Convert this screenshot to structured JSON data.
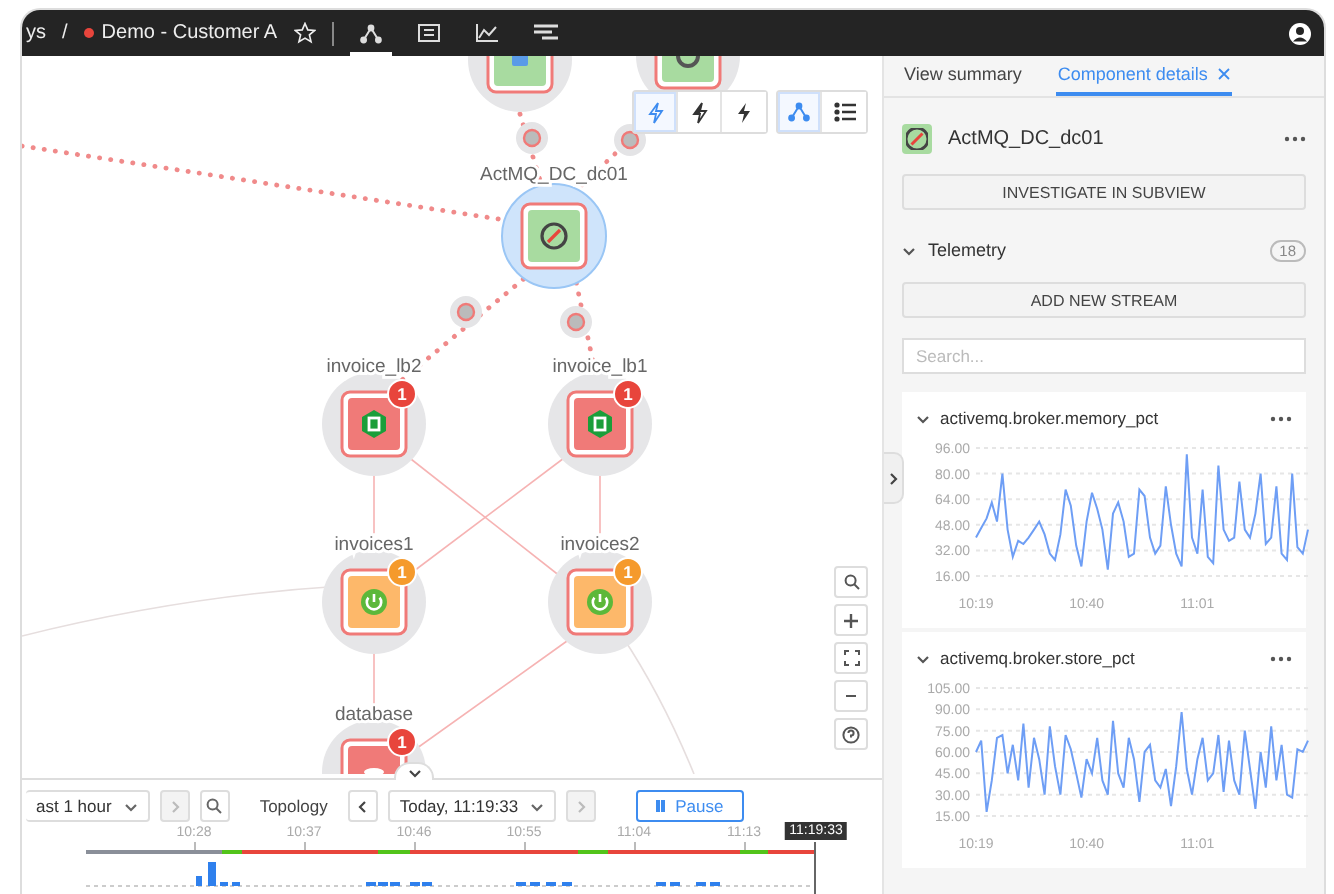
{
  "top_bar": {
    "breadcrumb": "ys",
    "separator": "/",
    "view": {
      "label": "Demo - Customer A",
      "color": "#e8453c",
      "favorite": false
    },
    "view_tabs": [
      {
        "kind": "topology",
        "selected": true
      },
      {
        "kind": "table",
        "selected": false
      },
      {
        "kind": "chart",
        "selected": false
      },
      {
        "kind": "events",
        "selected": false
      }
    ]
  },
  "graph_toolbar": {
    "filters": [
      {
        "kind": "bolt-outline",
        "selected": true
      },
      {
        "kind": "bolt-half",
        "selected": false
      },
      {
        "kind": "bolt",
        "selected": false
      }
    ],
    "views": [
      {
        "kind": "topology",
        "selected": true
      },
      {
        "kind": "list",
        "selected": false
      }
    ]
  },
  "graph": {
    "nodes": [
      {
        "kind": "app",
        "color": "#a8dba0",
        "selected": false
      },
      {
        "kind": "host",
        "color": "#a8dba0",
        "selected": false
      },
      {
        "label": "ActMQ_DC_dc01",
        "kind": "broker",
        "color": "#a8dba0",
        "selected": true
      },
      {
        "label": "invoice_lb2",
        "kind": "load-balancer",
        "color": "#f07a78",
        "badge": {
          "text": "1",
          "color": "#e8453c"
        },
        "selected": false
      },
      {
        "label": "invoice_lb1",
        "kind": "load-balancer",
        "color": "#f07a78",
        "badge": {
          "text": "1",
          "color": "#e8453c"
        },
        "selected": false
      },
      {
        "label": "invoices1",
        "kind": "service",
        "color": "#fdb86a",
        "badge": {
          "text": "1",
          "color": "#f59a2c"
        },
        "selected": false
      },
      {
        "label": "invoices2",
        "kind": "service",
        "color": "#fdb86a",
        "badge": {
          "text": "1",
          "color": "#f59a2c"
        },
        "selected": false
      },
      {
        "label": "database",
        "kind": "database",
        "color": "#f07a78",
        "badge": {
          "text": "1",
          "color": "#e8453c"
        },
        "selected": false
      }
    ]
  },
  "zoom_controls": [
    {
      "kind": "search"
    },
    {
      "kind": "zoom-in"
    },
    {
      "kind": "fit"
    },
    {
      "kind": "zoom-out"
    },
    {
      "kind": "help"
    }
  ],
  "timeline": {
    "expanded": true,
    "range": "ast 1 hour",
    "range_next_disabled": true,
    "mode": "Topology",
    "time": "Today, 11:19:33",
    "time_next_disabled": true,
    "pause": "Pause",
    "ticks": [
      "10:28",
      "10:37",
      "10:46",
      "10:55",
      "11:04",
      "11:13"
    ],
    "current": "11:19:33",
    "segments": [
      {
        "color": "#8a8f99"
      },
      {
        "color": "#52c41a"
      },
      {
        "color": "#e8453c"
      },
      {
        "color": "#52c41a"
      },
      {
        "color": "#e8453c"
      },
      {
        "color": "#52c41a"
      },
      {
        "color": "#e8453c"
      },
      {
        "color": "#52c41a"
      },
      {
        "color": "#e8453c"
      }
    ]
  },
  "panel": {
    "tabs": [
      {
        "label": "View summary",
        "selected": false,
        "closable": false
      },
      {
        "label": "Component details",
        "selected": true,
        "closable": true
      }
    ],
    "component": {
      "name": "ActMQ_DC_dc01",
      "color": "#a8dba0"
    },
    "investigate": "INVESTIGATE IN SUBVIEW",
    "telemetry": {
      "title": "Telemetry",
      "expanded": true,
      "count": "18",
      "add_button": "ADD NEW STREAM",
      "search": {
        "placeholder": "Search..."
      },
      "streams": [
        {
          "name": "activemq.broker.memory_pct",
          "expanded": true,
          "chart_data": {
            "type": "line",
            "grid": true,
            "ylim": [
              16,
              96
            ],
            "categories": [
              "10:19",
              null,
              null,
              null,
              null,
              null,
              null,
              null,
              null,
              null,
              null,
              null,
              null,
              null,
              null,
              null,
              null,
              null,
              null,
              null,
              null,
              "10:40",
              null,
              null,
              null,
              null,
              null,
              null,
              null,
              null,
              null,
              null,
              null,
              null,
              null,
              null,
              null,
              null,
              null,
              null,
              null,
              null,
              "11:01",
              null,
              null,
              null,
              null,
              null,
              null,
              null,
              null,
              null,
              null,
              null,
              null,
              null,
              null,
              null,
              null,
              null,
              null,
              null,
              null,
              null
            ],
            "yticks": [
              {
                "value": 16,
                "label": "16.00"
              },
              {
                "value": 32,
                "label": "32.00"
              },
              {
                "value": 48,
                "label": "48.00"
              },
              {
                "value": 64,
                "label": "64.00"
              },
              {
                "value": 80,
                "label": "80.00"
              },
              {
                "value": 96,
                "label": "96.00"
              }
            ],
            "series": [
              {
                "color": "#6e9ef5",
                "values": [
                  40,
                  46,
                  52,
                  62,
                  50,
                  80,
                  45,
                  28,
                  38,
                  36,
                  40,
                  45,
                  50,
                  42,
                  30,
                  26,
                  42,
                  70,
                  60,
                  35,
                  22,
                  50,
                  68,
                  58,
                  45,
                  20,
                  55,
                  62,
                  50,
                  28,
                  30,
                  70,
                  66,
                  40,
                  30,
                  35,
                  72,
                  48,
                  30,
                  22,
                  92,
                  40,
                  30,
                  70,
                  28,
                  24,
                  85,
                  45,
                  38,
                  40,
                  75,
                  45,
                  40,
                  55,
                  80,
                  36,
                  40,
                  72,
                  30,
                  26,
                  80,
                  34,
                  30,
                  45
                ]
              }
            ]
          }
        },
        {
          "name": "activemq.broker.store_pct",
          "expanded": true,
          "chart_data": {
            "type": "line",
            "grid": true,
            "ylim": [
              15,
              105
            ],
            "categories": [
              "10:19",
              null,
              null,
              null,
              null,
              null,
              null,
              null,
              null,
              null,
              null,
              null,
              null,
              null,
              null,
              null,
              null,
              null,
              null,
              null,
              null,
              "10:40",
              null,
              null,
              null,
              null,
              null,
              null,
              null,
              null,
              null,
              null,
              null,
              null,
              null,
              null,
              null,
              null,
              null,
              null,
              null,
              null,
              "11:01",
              null,
              null,
              null,
              null,
              null,
              null,
              null,
              null,
              null,
              null,
              null,
              null,
              null,
              null,
              null,
              null,
              null,
              null,
              null,
              null,
              null
            ],
            "yticks": [
              {
                "value": 15,
                "label": "15.00"
              },
              {
                "value": 30,
                "label": "30.00"
              },
              {
                "value": 45,
                "label": "45.00"
              },
              {
                "value": 60,
                "label": "60.00"
              },
              {
                "value": 75,
                "label": "75.00"
              },
              {
                "value": 90,
                "label": "90.00"
              },
              {
                "value": 105,
                "label": "105.00"
              }
            ],
            "series": [
              {
                "color": "#6e9ef5",
                "values": [
                  60,
                  68,
                  18,
                  40,
                  70,
                  72,
                  45,
                  65,
                  40,
                  80,
                  35,
                  70,
                  55,
                  30,
                  78,
                  50,
                  30,
                  72,
                  62,
                  45,
                  28,
                  55,
                  45,
                  70,
                  40,
                  30,
                  82,
                  45,
                  35,
                  70,
                  55,
                  25,
                  60,
                  65,
                  40,
                  35,
                  48,
                  22,
                  50,
                  88,
                  48,
                  30,
                  55,
                  70,
                  40,
                  45,
                  72,
                  32,
                  68,
                  40,
                  30,
                  75,
                  48,
                  20,
                  60,
                  35,
                  78,
                  40,
                  65,
                  30,
                  28,
                  62,
                  60,
                  68
                ]
              }
            ]
          }
        }
      ]
    }
  }
}
